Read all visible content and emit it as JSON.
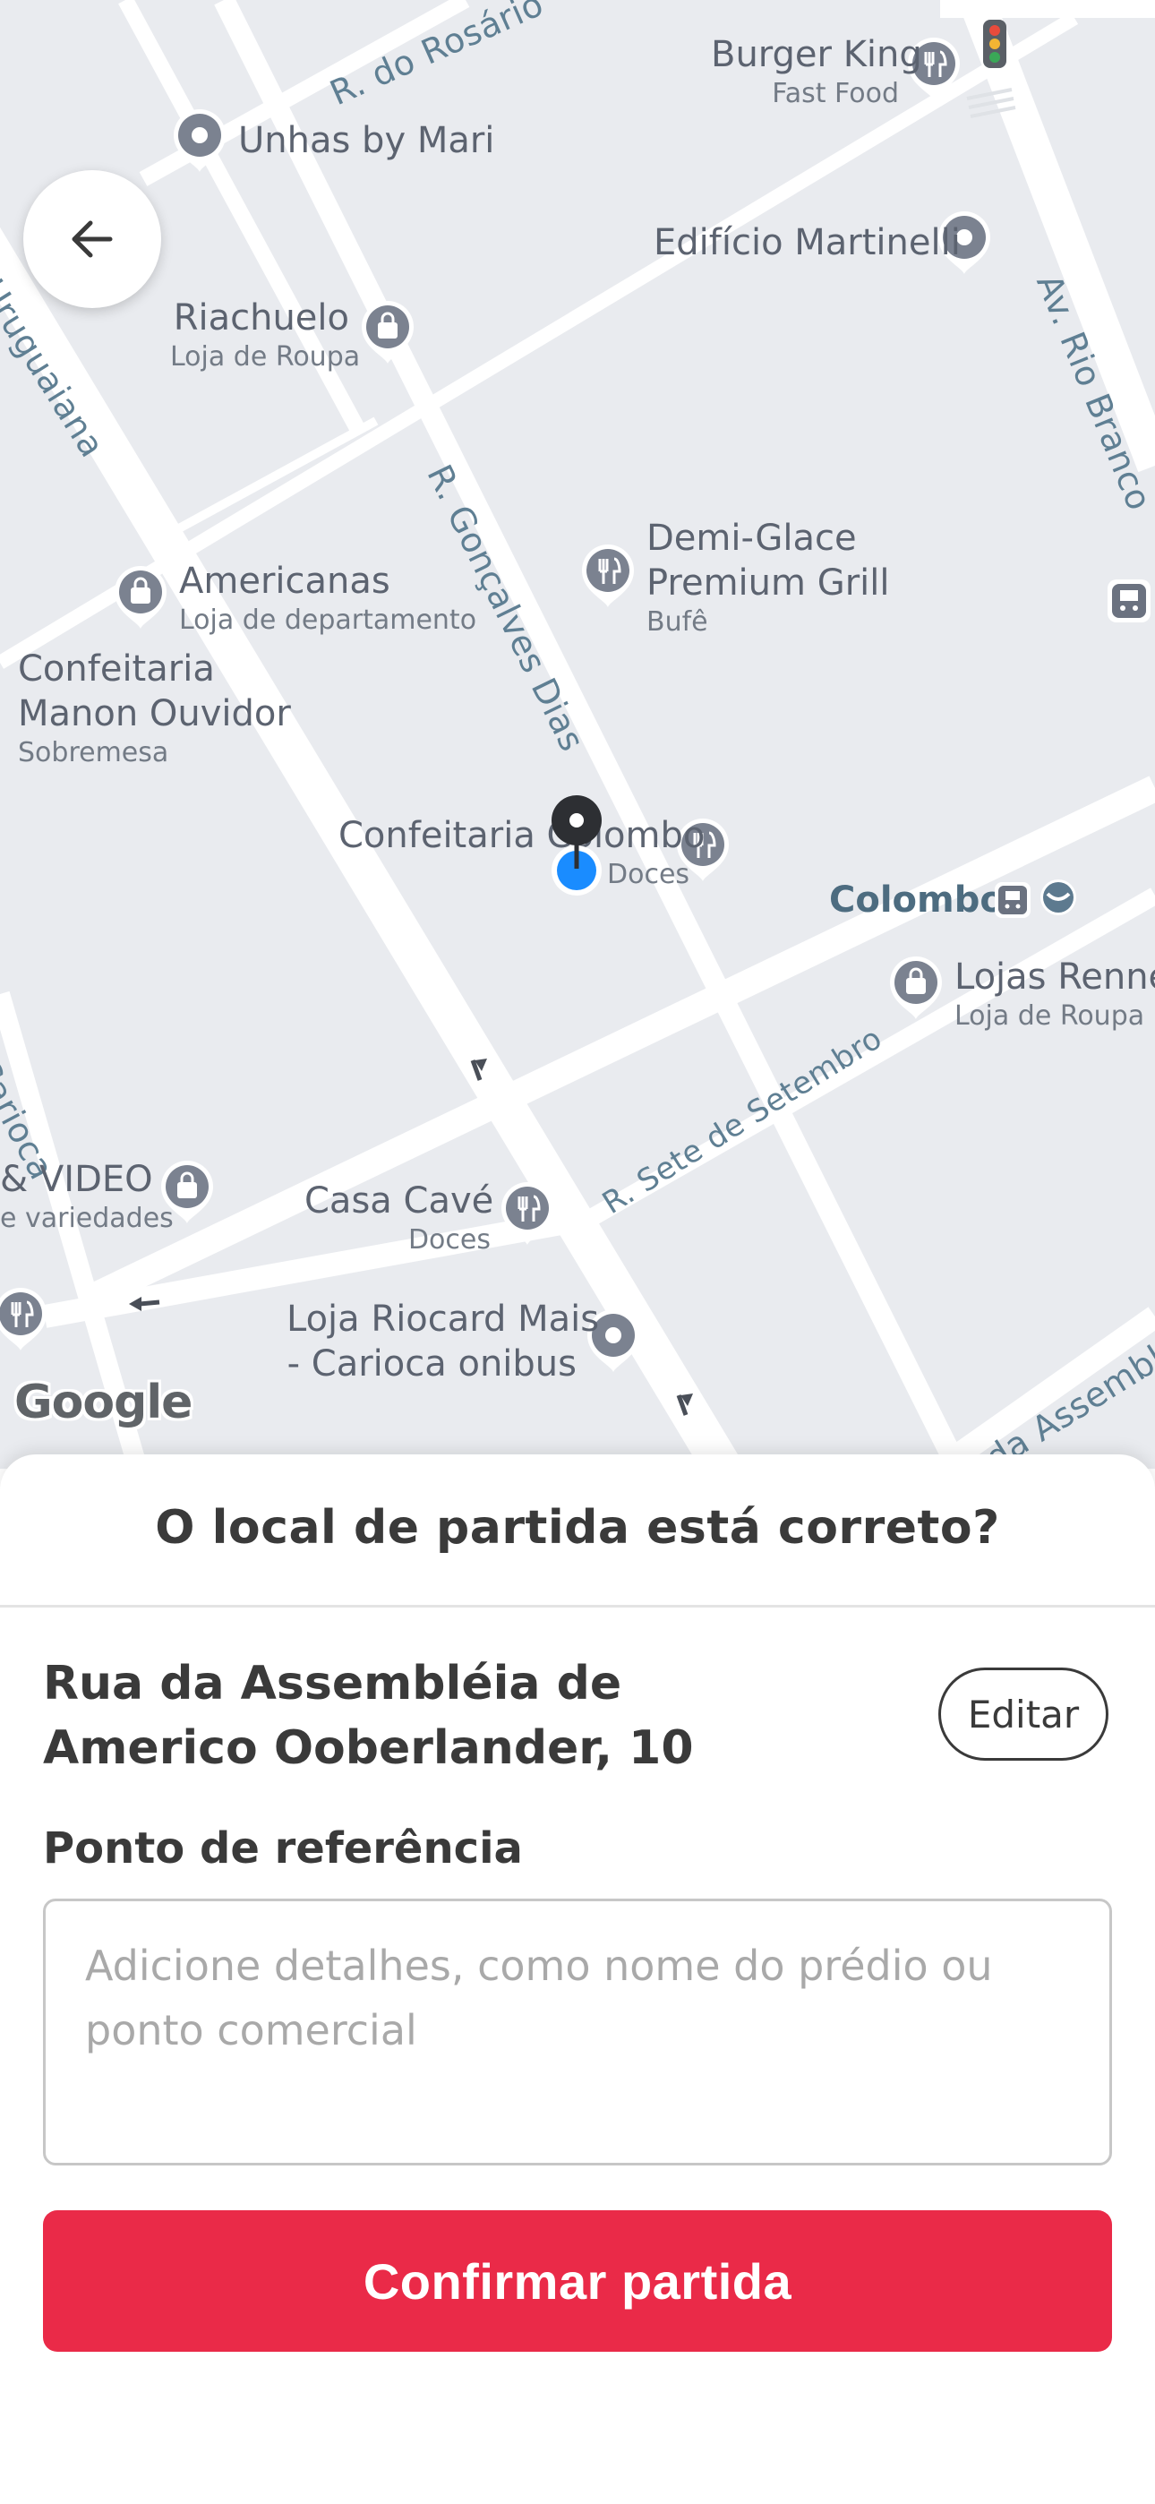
{
  "map": {
    "streets": [
      "R. do Rosário",
      "Uruguaiana",
      "R. Gonçalves Dias",
      "Av. Rio Branco",
      "R. Sete de Setembro",
      "R. da Assembléia",
      "Carioca"
    ],
    "pois": [
      {
        "title": "Burger King",
        "subtitle": "Fast Food"
      },
      {
        "title": "Unhas by Mari",
        "subtitle": ""
      },
      {
        "title": "Edifício Martinelli",
        "subtitle": ""
      },
      {
        "title": "Riachuelo",
        "subtitle": "Loja de Roupa"
      },
      {
        "title": "Demi-Glace",
        "subtitle": ""
      },
      {
        "title": "Premium Grill",
        "subtitle": "Bufê"
      },
      {
        "title": "Americanas",
        "subtitle": "Loja de departamento"
      },
      {
        "title": "Confeitaria",
        "subtitle": ""
      },
      {
        "title": "Manon Ouvidor",
        "subtitle": "Sobremesa"
      },
      {
        "title": "Confeitaria Colombo",
        "subtitle": "Doces"
      },
      {
        "title": "Colombo",
        "subtitle": ""
      },
      {
        "title": "Lojas Renner",
        "subtitle": "Loja de Roupa"
      },
      {
        "title": "& VIDEO",
        "subtitle": "e variedades"
      },
      {
        "title": "Casa Cavé",
        "subtitle": "Doces"
      },
      {
        "title": "Loja Riocard Mais",
        "subtitle": ""
      },
      {
        "title": "- Carioca onibus",
        "subtitle": ""
      }
    ],
    "logo": "Google",
    "icons": [
      "back-arrow-icon",
      "restaurant-icon",
      "shopping-bag-icon",
      "place-icon",
      "bus-icon",
      "metro-icon",
      "traffic-light-icon",
      "pickup-pin-icon"
    ]
  },
  "sheet": {
    "title": "O local de partida está correto?",
    "address": "Rua da Assembléia de Americo Ooberlander, 10",
    "edit_label": "Editar",
    "reference_label": "Ponto de referência",
    "reference_placeholder": "Adicione detalhes, como nome do prédio ou ponto comercial",
    "confirm_label": "Confirmar partida"
  },
  "colors": {
    "accent": "#ea2a48",
    "map_background": "#e9ebef",
    "road": "#ffffff",
    "street_label": "#5f7f93",
    "user_location": "#1a8cff"
  }
}
